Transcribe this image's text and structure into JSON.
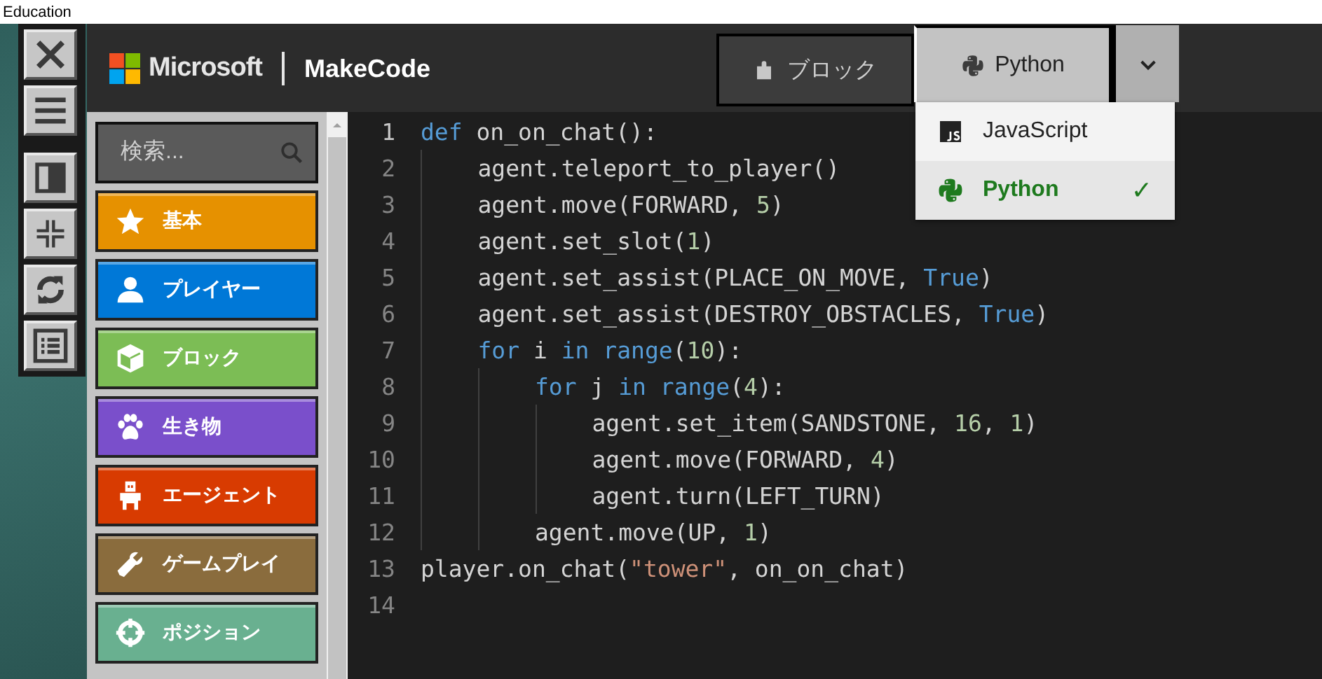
{
  "title_bar": {
    "title": "Education"
  },
  "header": {
    "brand": "Microsoft",
    "product": "MakeCode"
  },
  "editor_tabs": [
    {
      "label": "ブロック",
      "kind": "blocks",
      "selected": false
    },
    {
      "label": "Python",
      "kind": "python",
      "selected": true
    }
  ],
  "language_menu": {
    "check_mark": "✓",
    "items": [
      {
        "label": "JavaScript",
        "kind": "javascript",
        "selected": false
      },
      {
        "label": "Python",
        "kind": "python",
        "selected": true
      }
    ]
  },
  "toolbox": {
    "search": {
      "placeholder": "検索..."
    },
    "categories": [
      {
        "label": "基本",
        "kind": "star",
        "color": "#e69100"
      },
      {
        "label": "プレイヤー",
        "kind": "person",
        "color": "#0078d7"
      },
      {
        "label": "ブロック",
        "kind": "cube",
        "color": "#7cbd55"
      },
      {
        "label": "生き物",
        "kind": "paw",
        "color": "#7a4fcb"
      },
      {
        "label": "エージェント",
        "kind": "agent",
        "color": "#d83b01"
      },
      {
        "label": "ゲームプレイ",
        "kind": "wrench",
        "color": "#8a6c3d"
      },
      {
        "label": "ポジション",
        "kind": "target",
        "color": "#69b090"
      }
    ]
  },
  "code": {
    "lines": [
      {
        "number": "1",
        "tokens": [
          {
            "kind": "keyword",
            "text": "def"
          },
          {
            "kind": "plain",
            "text": " on_on_chat():"
          }
        ]
      },
      {
        "number": "2",
        "tokens": [
          {
            "kind": "plain",
            "text": "    agent.teleport_to_player()"
          }
        ]
      },
      {
        "number": "3",
        "tokens": [
          {
            "kind": "plain",
            "text": "    agent.move(FORWARD, "
          },
          {
            "kind": "number",
            "text": "5"
          },
          {
            "kind": "plain",
            "text": ")"
          }
        ]
      },
      {
        "number": "4",
        "tokens": [
          {
            "kind": "plain",
            "text": "    agent.set_slot("
          },
          {
            "kind": "number",
            "text": "1"
          },
          {
            "kind": "plain",
            "text": ")"
          }
        ]
      },
      {
        "number": "5",
        "tokens": [
          {
            "kind": "plain",
            "text": "    agent.set_assist(PLACE_ON_MOVE, "
          },
          {
            "kind": "keyword",
            "text": "True"
          },
          {
            "kind": "plain",
            "text": ")"
          }
        ]
      },
      {
        "number": "6",
        "tokens": [
          {
            "kind": "plain",
            "text": "    agent.set_assist(DESTROY_OBSTACLES, "
          },
          {
            "kind": "keyword",
            "text": "True"
          },
          {
            "kind": "plain",
            "text": ")"
          }
        ]
      },
      {
        "number": "7",
        "tokens": [
          {
            "kind": "keyword",
            "text": "    for"
          },
          {
            "kind": "plain",
            "text": " i "
          },
          {
            "kind": "keyword",
            "text": "in range"
          },
          {
            "kind": "plain",
            "text": "("
          },
          {
            "kind": "number",
            "text": "10"
          },
          {
            "kind": "plain",
            "text": "):"
          }
        ]
      },
      {
        "number": "8",
        "tokens": [
          {
            "kind": "keyword",
            "text": "        for"
          },
          {
            "kind": "plain",
            "text": " j "
          },
          {
            "kind": "keyword",
            "text": "in range"
          },
          {
            "kind": "plain",
            "text": "("
          },
          {
            "kind": "number",
            "text": "4"
          },
          {
            "kind": "plain",
            "text": "):"
          }
        ]
      },
      {
        "number": "9",
        "tokens": [
          {
            "kind": "plain",
            "text": "            agent.set_item(SANDSTONE, "
          },
          {
            "kind": "number",
            "text": "16"
          },
          {
            "kind": "plain",
            "text": ", "
          },
          {
            "kind": "number",
            "text": "1"
          },
          {
            "kind": "plain",
            "text": ")"
          }
        ]
      },
      {
        "number": "10",
        "tokens": [
          {
            "kind": "plain",
            "text": "            agent.move(FORWARD, "
          },
          {
            "kind": "number",
            "text": "4"
          },
          {
            "kind": "plain",
            "text": ")"
          }
        ]
      },
      {
        "number": "11",
        "tokens": [
          {
            "kind": "plain",
            "text": "            agent.turn(LEFT_TURN)"
          }
        ]
      },
      {
        "number": "12",
        "tokens": [
          {
            "kind": "plain",
            "text": "        agent.move(UP, "
          },
          {
            "kind": "number",
            "text": "1"
          },
          {
            "kind": "plain",
            "text": ")"
          }
        ]
      },
      {
        "number": "13",
        "tokens": [
          {
            "kind": "plain",
            "text": "player.on_chat("
          },
          {
            "kind": "string",
            "text": "\"tower\""
          },
          {
            "kind": "plain",
            "text": ", on_on_chat)"
          }
        ]
      },
      {
        "number": "14"
      }
    ]
  }
}
